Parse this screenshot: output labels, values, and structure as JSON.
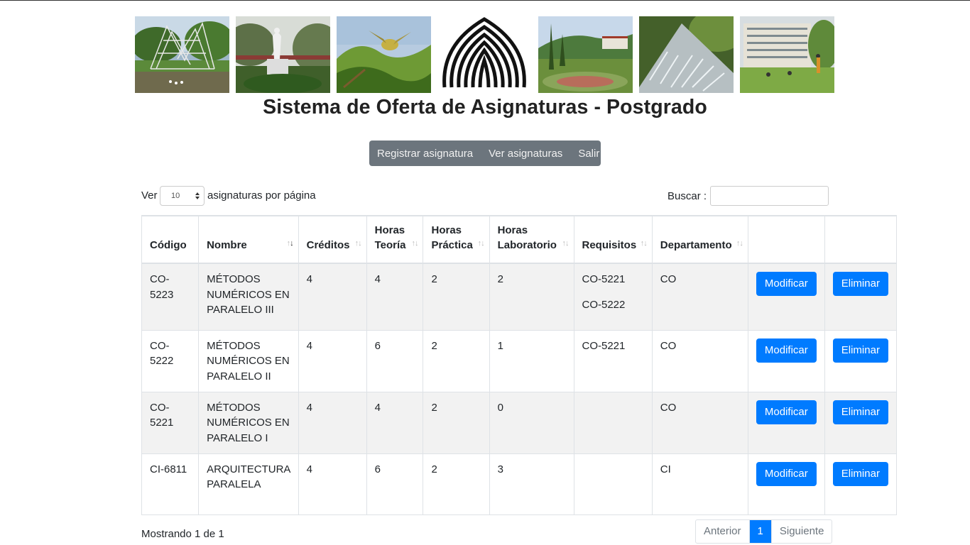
{
  "header": {
    "title": "Sistema de Oferta de Asignaturas - Postgrado"
  },
  "banner": {
    "photos": [
      {
        "name": "garden-sculpture-photo"
      },
      {
        "name": "statue-photo"
      },
      {
        "name": "bird-photo"
      },
      {
        "name": "university-logo"
      },
      {
        "name": "campus-gardens-photo"
      },
      {
        "name": "waterfall-fountain-photo"
      },
      {
        "name": "building-lawn-photo"
      }
    ]
  },
  "nav": {
    "items": [
      "Registrar asignatura",
      "Ver asignaturas",
      "Salir"
    ]
  },
  "controls": {
    "length_prefix": "Ver",
    "length_value": "10",
    "length_suffix": "asignaturas por página",
    "search_label": "Buscar :",
    "search_value": ""
  },
  "table": {
    "columns": [
      {
        "label": "Código",
        "sortable": false
      },
      {
        "label": "Nombre",
        "sortable": true,
        "sorted": "desc"
      },
      {
        "label": "Créditos",
        "sortable": true
      },
      {
        "label": "Horas Teoría",
        "sortable": true
      },
      {
        "label": "Horas Práctica",
        "sortable": true
      },
      {
        "label": "Horas Laboratorio",
        "sortable": true
      },
      {
        "label": "Requisitos",
        "sortable": true
      },
      {
        "label": "Departamento",
        "sortable": true
      },
      {
        "label": "",
        "sortable": false
      },
      {
        "label": "",
        "sortable": false
      }
    ],
    "rows": [
      {
        "codigo": "CO-5223",
        "nombre": "MÉTODOS NUMÉRICOS EN PARALELO III",
        "creditos": "4",
        "teoria": "4",
        "practica": "2",
        "laboratorio": "2",
        "requisitos": [
          "CO-5221",
          "CO-5222"
        ],
        "departamento": "CO",
        "modify_label": "Modificar",
        "delete_label": "Eliminar"
      },
      {
        "codigo": "CO-5222",
        "nombre": "MÉTODOS NUMÉRICOS EN PARALELO II",
        "creditos": "4",
        "teoria": "6",
        "practica": "2",
        "laboratorio": "1",
        "requisitos": [
          "CO-5221"
        ],
        "departamento": "CO",
        "modify_label": "Modificar",
        "delete_label": "Eliminar"
      },
      {
        "codigo": "CO-5221",
        "nombre": "MÉTODOS NUMÉRICOS EN PARALELO I",
        "creditos": "4",
        "teoria": "4",
        "practica": "2",
        "laboratorio": "0",
        "requisitos": [],
        "departamento": "CO",
        "modify_label": "Modificar",
        "delete_label": "Eliminar"
      },
      {
        "codigo": "CI-6811",
        "nombre": "ARQUITECTURA PARALELA",
        "creditos": "4",
        "teoria": "6",
        "practica": "2",
        "laboratorio": "3",
        "requisitos": [],
        "departamento": "CI",
        "modify_label": "Modificar",
        "delete_label": "Eliminar"
      }
    ]
  },
  "footer": {
    "info": "Mostrando 1 de 1",
    "prev_label": "Anterior",
    "current_page": "1",
    "next_label": "Siguiente"
  },
  "colors": {
    "nav_bg": "#6c757d",
    "primary": "#007bff",
    "stripe": "#f2f2f2"
  }
}
